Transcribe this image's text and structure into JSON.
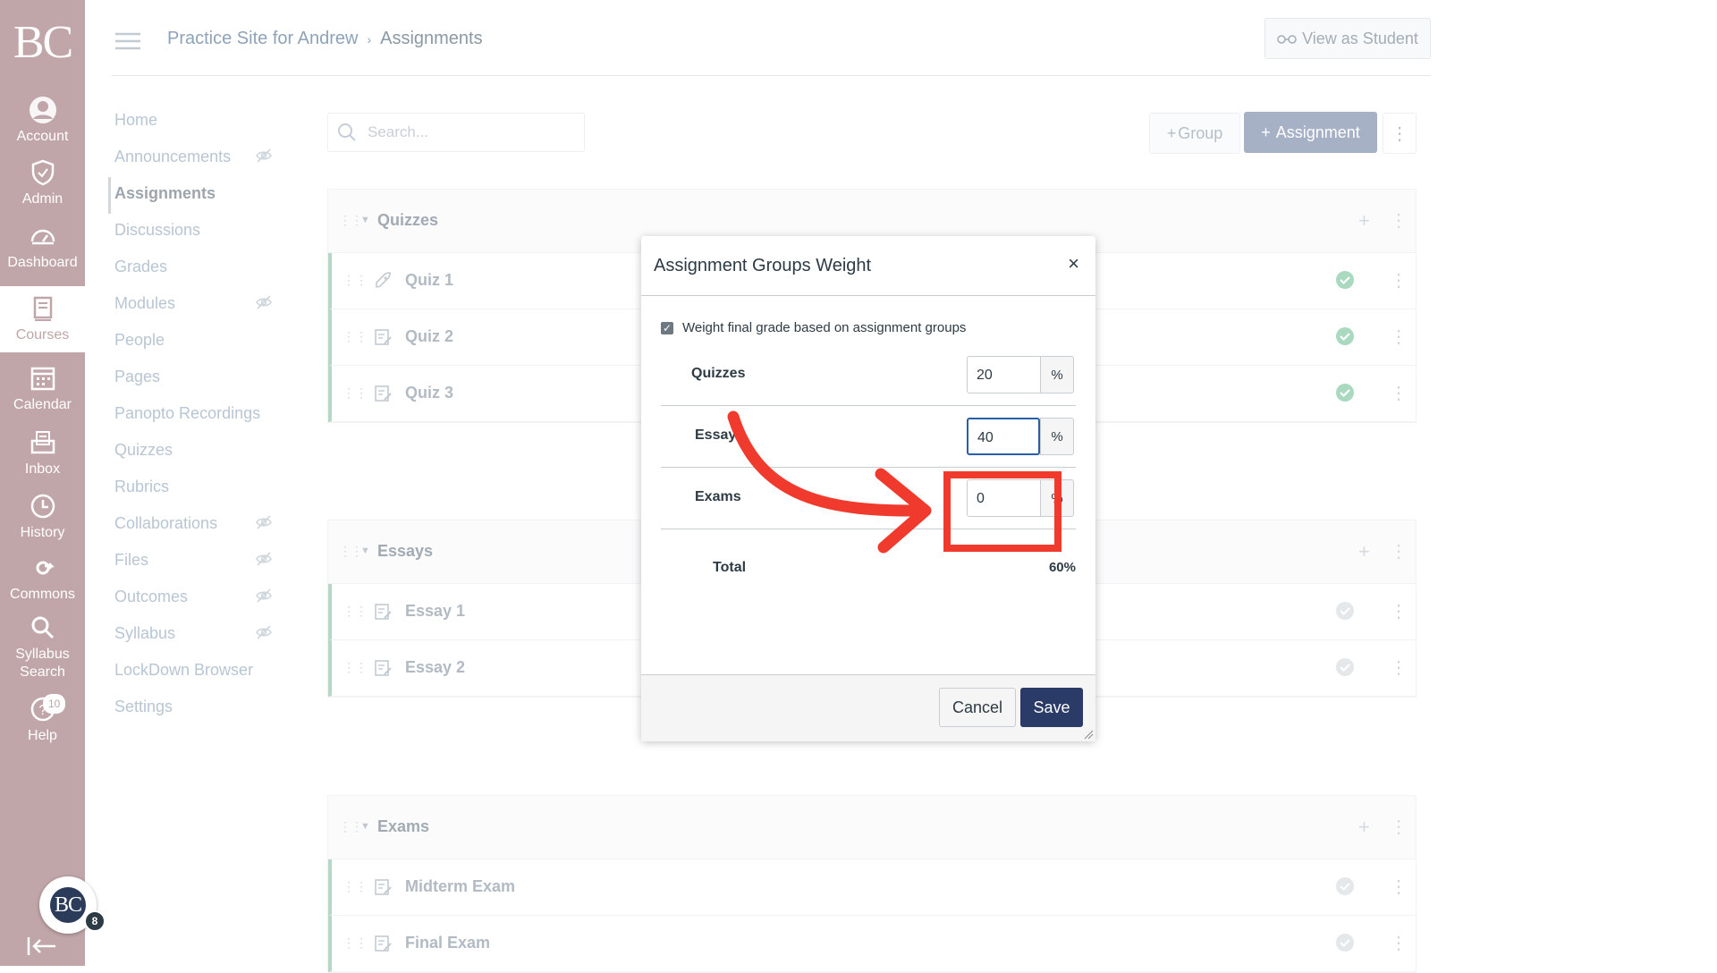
{
  "global_nav": {
    "logo": "BC",
    "items": [
      {
        "label": "Account",
        "icon": "account-icon"
      },
      {
        "label": "Admin",
        "icon": "shield-icon"
      },
      {
        "label": "Dashboard",
        "icon": "dashboard-icon"
      },
      {
        "label": "Courses",
        "icon": "book-icon"
      },
      {
        "label": "Calendar",
        "icon": "calendar-icon"
      },
      {
        "label": "Inbox",
        "icon": "inbox-icon"
      },
      {
        "label": "History",
        "icon": "clock-icon"
      },
      {
        "label": "Commons",
        "icon": "commons-icon"
      },
      {
        "label": "Syllabus Search",
        "icon": "search-icon"
      },
      {
        "label": "Help",
        "icon": "help-icon",
        "badge": "10"
      }
    ],
    "avatar_initials": "BC",
    "avatar_badge": "8"
  },
  "header": {
    "course": "Practice Site for Andrew",
    "current": "Assignments",
    "view_as_student": "View as Student"
  },
  "course_nav": [
    {
      "label": "Home",
      "hidden": false
    },
    {
      "label": "Announcements",
      "hidden": true
    },
    {
      "label": "Assignments",
      "hidden": false,
      "active": true
    },
    {
      "label": "Discussions",
      "hidden": false
    },
    {
      "label": "Grades",
      "hidden": false
    },
    {
      "label": "Modules",
      "hidden": true
    },
    {
      "label": "People",
      "hidden": false
    },
    {
      "label": "Pages",
      "hidden": false
    },
    {
      "label": "Panopto Recordings",
      "hidden": false
    },
    {
      "label": "Quizzes",
      "hidden": false
    },
    {
      "label": "Rubrics",
      "hidden": false
    },
    {
      "label": "Collaborations",
      "hidden": true
    },
    {
      "label": "Files",
      "hidden": true
    },
    {
      "label": "Outcomes",
      "hidden": true
    },
    {
      "label": "Syllabus",
      "hidden": true
    },
    {
      "label": "LockDown Browser",
      "hidden": false
    },
    {
      "label": "Settings",
      "hidden": false
    }
  ],
  "toolbar": {
    "search_placeholder": "Search...",
    "group_label": "Group",
    "assignment_label": "Assignment"
  },
  "groups": [
    {
      "name": "Quizzes",
      "items": [
        {
          "name": "Quiz 1",
          "icon": "rocket-icon",
          "published": true
        },
        {
          "name": "Quiz 2",
          "icon": "quiz-icon",
          "published": true
        },
        {
          "name": "Quiz 3",
          "icon": "quiz-icon",
          "published": true
        }
      ]
    },
    {
      "name": "Essays",
      "items": [
        {
          "name": "Essay 1",
          "icon": "assignment-icon",
          "published": false
        },
        {
          "name": "Essay 2",
          "icon": "assignment-icon",
          "published": false
        }
      ]
    },
    {
      "name": "Exams",
      "items": [
        {
          "name": "Midterm Exam",
          "icon": "assignment-icon",
          "published": false
        },
        {
          "name": "Final Exam",
          "icon": "assignment-icon",
          "published": false
        }
      ]
    }
  ],
  "modal": {
    "title": "Assignment Groups Weight",
    "close": "×",
    "checkbox_label": "Weight final grade based on assignment groups",
    "checkbox_checked": true,
    "weights": [
      {
        "label": "Quizzes",
        "value": "20",
        "unit": "%"
      },
      {
        "label": "Essays",
        "value": "40",
        "unit": "%"
      },
      {
        "label": "Exams",
        "value": "0",
        "unit": "%"
      }
    ],
    "total_label": "Total",
    "total_value": "60%",
    "cancel": "Cancel",
    "save": "Save"
  },
  "colors": {
    "nav_bg": "#c0a6a9",
    "save_bg": "#2b3b67",
    "annotation": "#f03a2e"
  }
}
